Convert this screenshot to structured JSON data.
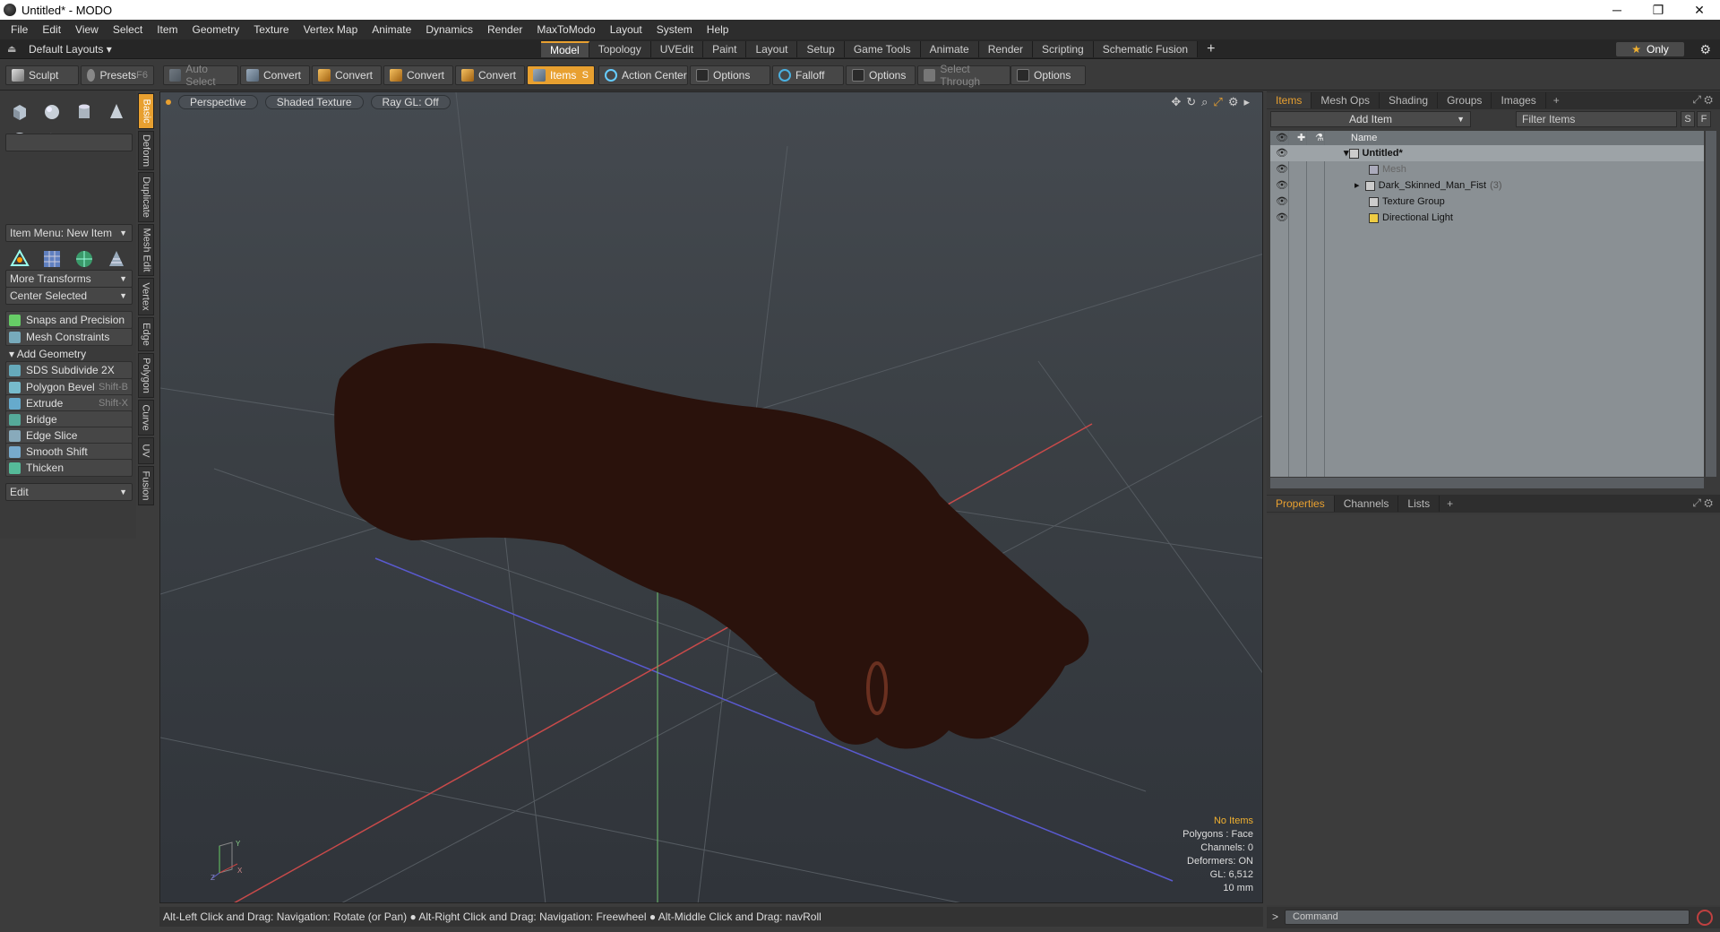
{
  "window": {
    "title": "Untitled* - MODO",
    "minimize": "─",
    "maximize": "❐",
    "close": "✕"
  },
  "menu": [
    "File",
    "Edit",
    "View",
    "Select",
    "Item",
    "Geometry",
    "Texture",
    "Vertex Map",
    "Animate",
    "Dynamics",
    "Render",
    "MaxToModo",
    "Layout",
    "System",
    "Help"
  ],
  "layout": {
    "dropdown": "Default Layouts",
    "tabs": [
      "Model",
      "Topology",
      "UVEdit",
      "Paint",
      "Layout",
      "Setup",
      "Game Tools",
      "Animate",
      "Render",
      "Scripting",
      "Schematic Fusion"
    ],
    "active_tab": "Model",
    "add": "+",
    "only": "Only"
  },
  "toolbar": {
    "sculpt": "Sculpt",
    "presets": "Presets",
    "presets_shortcut": "F6",
    "auto_select": "Auto Select",
    "convert": "Convert",
    "items": "Items",
    "items_shortcut": "S",
    "action_center": "Action Center",
    "options": "Options",
    "falloff": "Falloff",
    "select_through": "Select Through"
  },
  "left": {
    "item_menu": "Item Menu: New Item",
    "more_transforms": "More Transforms",
    "center_selected": "Center Selected",
    "snaps": "Snaps and Precision",
    "mesh_constraints": "Mesh Constraints",
    "add_geometry": "Add Geometry",
    "tools": [
      {
        "label": "SDS Subdivide 2X",
        "shortcut": ""
      },
      {
        "label": "Polygon Bevel",
        "shortcut": "Shift-B"
      },
      {
        "label": "Extrude",
        "shortcut": "Shift-X"
      },
      {
        "label": "Bridge",
        "shortcut": ""
      },
      {
        "label": "Edge Slice",
        "shortcut": ""
      },
      {
        "label": "Smooth Shift",
        "shortcut": ""
      },
      {
        "label": "Thicken",
        "shortcut": ""
      }
    ],
    "edit": "Edit",
    "vtabs": [
      "Basic",
      "Deform",
      "Duplicate",
      "Mesh Edit",
      "Vertex",
      "Edge",
      "Polygon",
      "Curve",
      "UV",
      "Fusion"
    ]
  },
  "viewport": {
    "view": "Perspective",
    "shading": "Shaded Texture",
    "raygl": "Ray GL: Off",
    "info": {
      "items": "No Items",
      "polygons": "Polygons : Face",
      "channels": "Channels: 0",
      "deformers": "Deformers: ON",
      "gl": "GL: 6,512",
      "scale": "10 mm"
    },
    "axis_labels": {
      "x": "X",
      "y": "Y",
      "z": "Z"
    }
  },
  "status": "Alt-Left Click and Drag: Navigation: Rotate (or Pan) ● Alt-Right Click and Drag: Navigation: Freewheel ● Alt-Middle Click and Drag: navRoll",
  "items_panel": {
    "tabs": [
      "Items",
      "Mesh Ops",
      "Shading",
      "Groups",
      "Images"
    ],
    "active_tab": "Items",
    "add_item": "Add Item",
    "filter": "Filter Items",
    "s_btn": "S",
    "f_btn": "F",
    "name_col": "Name",
    "rows": [
      {
        "name": "Untitled*",
        "count": ""
      },
      {
        "name": "Mesh",
        "count": ""
      },
      {
        "name": "Dark_Skinned_Man_Fist",
        "count": "(3)"
      },
      {
        "name": "Texture Group",
        "count": ""
      },
      {
        "name": "Directional Light",
        "count": ""
      }
    ]
  },
  "props_panel": {
    "tabs": [
      "Properties",
      "Channels",
      "Lists"
    ],
    "active_tab": "Properties"
  },
  "command": {
    "prompt": ">",
    "placeholder": "Command"
  },
  "colors": {
    "accent": "#e8a030",
    "viewport_bg": "#3a3f44",
    "list_bg": "#8a9094"
  }
}
